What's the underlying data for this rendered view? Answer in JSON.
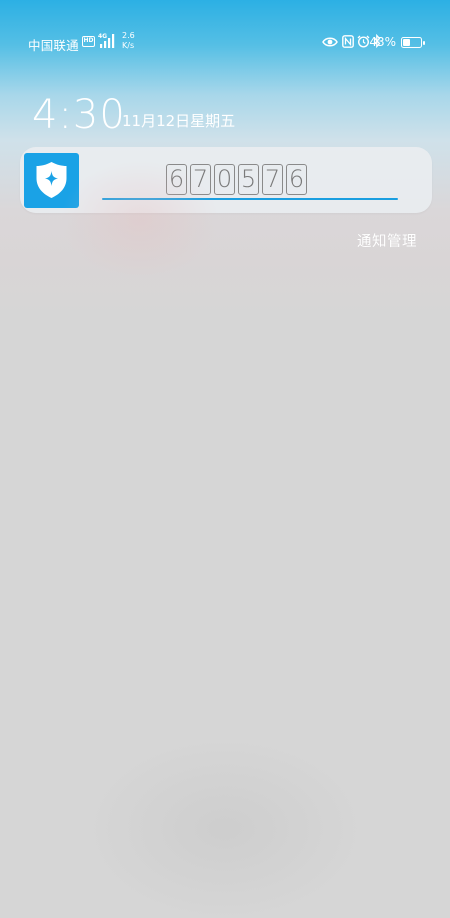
{
  "status_bar": {
    "carrier": "中国联通",
    "hd_badge": "HD",
    "network_type": "4G",
    "speed_value": "2.6",
    "speed_unit": "K/s",
    "battery_percent_text": "43%",
    "battery_level": 43,
    "icons": [
      "eye-icon",
      "nfc-icon",
      "alarm-icon",
      "bluetooth-icon",
      "battery-icon",
      "signal-icon"
    ]
  },
  "lockscreen": {
    "time": "4:30",
    "date": "11月12日星期五"
  },
  "notification": {
    "app_icon": "shield-star-icon",
    "code_digits": [
      "6",
      "7",
      "0",
      "5",
      "7",
      "6"
    ],
    "manage_label": "通知管理"
  },
  "colors": {
    "top_blue": "#2cb0e4",
    "app_icon_bg": "#1aa2e6",
    "underline": "#1a9ee0",
    "background_gray": "#d6d6d6"
  }
}
